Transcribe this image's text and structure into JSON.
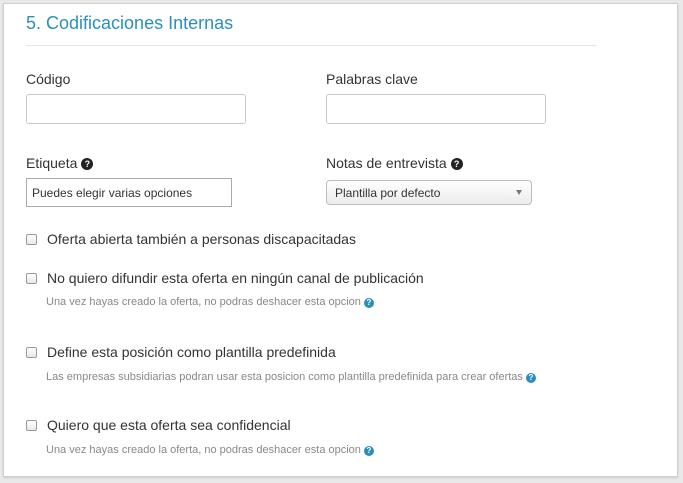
{
  "section": {
    "title": "5. Codificaciones Internas"
  },
  "fields": {
    "codigo_label": "Código",
    "palabras_label": "Palabras clave",
    "etiqueta_label": "Etiqueta",
    "etiqueta_placeholder": "Puedes elegir varias opciones",
    "notas_label": "Notas de entrevista",
    "notas_selected": "Plantilla por defecto"
  },
  "options": [
    {
      "label": "Oferta abierta también a personas discapacitadas",
      "checked": false,
      "hint": ""
    },
    {
      "label": "No quiero difundir esta oferta en ningún canal de publicación",
      "checked": false,
      "hint": "Una vez hayas creado la oferta, no podras deshacer esta opcion"
    },
    {
      "label": "Define esta posición como plantilla predefinida",
      "checked": false,
      "hint": "Las empresas subsidiarias podran usar esta posicion como plantilla predefinida para crear ofertas"
    },
    {
      "label": "Quiero que esta oferta sea confidencial",
      "checked": false,
      "hint": "Una vez hayas creado la oferta, no podras deshacer esta opcion"
    }
  ],
  "icons": {
    "help": "question-circle-icon",
    "help_symbol": "?"
  },
  "colors": {
    "accent": "#2a8fbd",
    "hint_text": "#888888"
  }
}
